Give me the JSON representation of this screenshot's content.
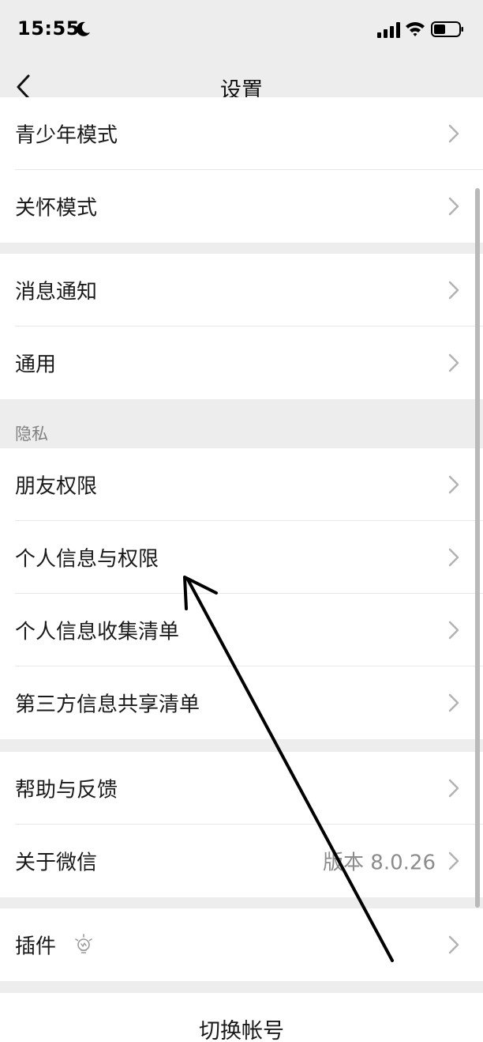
{
  "status_bar": {
    "time": "15:55"
  },
  "nav": {
    "title": "设置"
  },
  "groups": [
    {
      "items": [
        {
          "label": "青少年模式"
        },
        {
          "label": "关怀模式"
        }
      ]
    },
    {
      "items": [
        {
          "label": "消息通知"
        },
        {
          "label": "通用"
        }
      ]
    },
    {
      "items": [
        {
          "label": "朋友权限"
        },
        {
          "label": "个人信息与权限"
        },
        {
          "label": "个人信息收集清单"
        },
        {
          "label": "第三方信息共享清单"
        }
      ]
    },
    {
      "items": [
        {
          "label": "帮助与反馈"
        },
        {
          "label": "关于微信",
          "value": "版本 8.0.26"
        }
      ]
    },
    {
      "items": [
        {
          "label": "插件"
        }
      ]
    }
  ],
  "privacy_section": {
    "header": "隐私"
  },
  "footer": {
    "switch_account": "切换帐号"
  },
  "colors": {
    "background": "#ededed",
    "row": "#ffffff",
    "text": "#191919",
    "secondary_text": "#808080",
    "chevron": "#b2b2b2"
  },
  "icons": {
    "back": "chevron-left-icon",
    "row_chevron": "chevron-right-icon",
    "plugin": "lightbulb-icon",
    "moon": "moon-icon",
    "signal": "signal-icon",
    "wifi": "wifi-icon",
    "battery": "battery-icon"
  }
}
